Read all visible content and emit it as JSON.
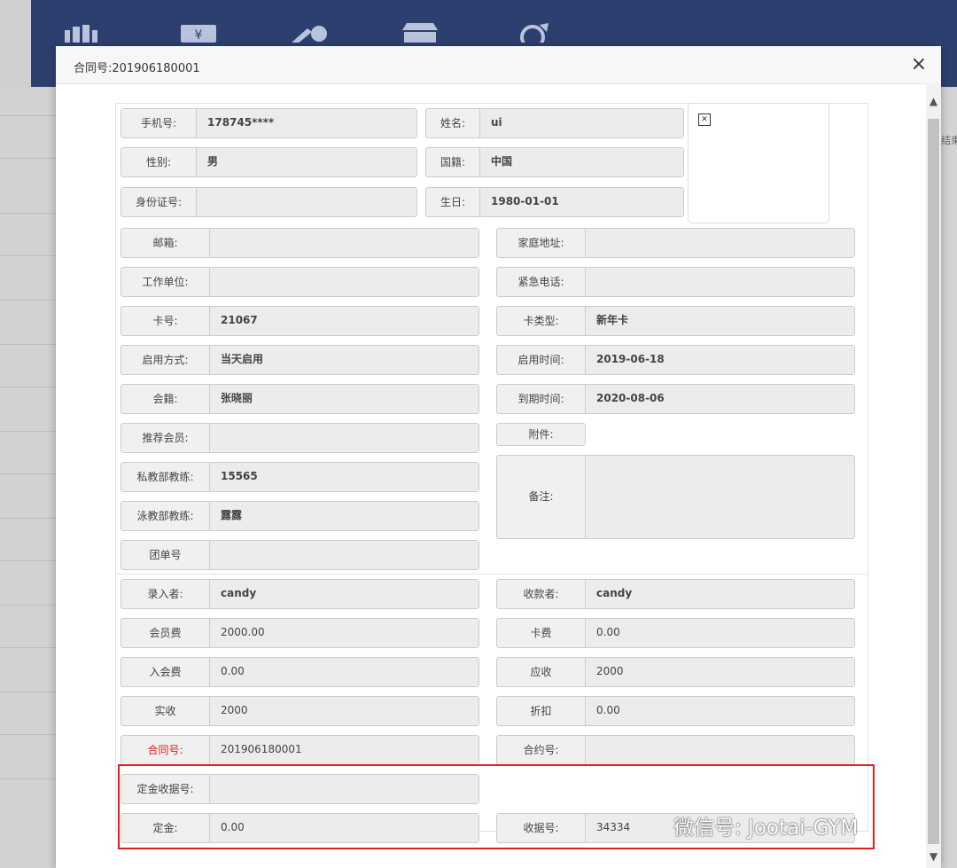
{
  "modal": {
    "title": "合同号:201906180001",
    "close": "×"
  },
  "icons": [
    "books-icon",
    "money-icon",
    "pen-icon",
    "store-icon",
    "wrench-icon"
  ],
  "background": {
    "right_text": "结束"
  },
  "member": {
    "phone": {
      "label": "手机号:",
      "value": "178745****"
    },
    "name": {
      "label": "姓名:",
      "value": "ui"
    },
    "gender": {
      "label": "性别:",
      "value": "男"
    },
    "nationality": {
      "label": "国籍:",
      "value": "中国"
    },
    "id_number": {
      "label": "身份证号:",
      "value": ""
    },
    "birthday": {
      "label": "生日:",
      "value": "1980-01-01"
    },
    "email": {
      "label": "邮箱:",
      "value": ""
    },
    "address": {
      "label": "家庭地址:",
      "value": ""
    },
    "employer": {
      "label": "工作单位:",
      "value": ""
    },
    "emergency_phone": {
      "label": "紧急电话:",
      "value": ""
    },
    "card_no": {
      "label": "卡号:",
      "value": "21067"
    },
    "card_type": {
      "label": "卡类型:",
      "value": "新年卡"
    },
    "activation": {
      "label": "启用方式:",
      "value": "当天启用"
    },
    "activation_date": {
      "label": "启用时间:",
      "value": "2019-06-18"
    },
    "membership": {
      "label": "会籍:",
      "value": "张晓丽"
    },
    "expiry": {
      "label": "到期时间:",
      "value": "2020-08-06"
    },
    "referrer": {
      "label": "推荐会员:",
      "value": ""
    },
    "attachment": {
      "label": "附件:",
      "value": ""
    },
    "pt_coach": {
      "label": "私教部教练:",
      "value": "15565"
    },
    "notes": {
      "label": "备注:",
      "value": ""
    },
    "swim_coach": {
      "label": "泳教部教练:",
      "value": "露露"
    },
    "group_no": {
      "label": "团单号",
      "value": ""
    }
  },
  "payment": {
    "entered_by": {
      "label": "录入者:",
      "value": "candy"
    },
    "collector": {
      "label": "收款者:",
      "value": "candy"
    },
    "member_fee": {
      "label": "会员费",
      "value": "2000.00"
    },
    "card_fee": {
      "label": "卡费",
      "value": "0.00"
    },
    "join_fee": {
      "label": "入会费",
      "value": "0.00"
    },
    "receivable": {
      "label": "应收",
      "value": "2000"
    },
    "received": {
      "label": "实收",
      "value": "2000"
    },
    "discount": {
      "label": "折扣",
      "value": "0.00"
    },
    "contract_no": {
      "label": "合同号:",
      "value": "201906180001"
    },
    "agreement_no": {
      "label": "合约号:",
      "value": ""
    },
    "deposit_receipt": {
      "label": "定金收据号:",
      "value": ""
    },
    "deposit": {
      "label": "定金:",
      "value": "0.00"
    },
    "receipt_no": {
      "label": "收据号:",
      "value": "34334"
    }
  },
  "watermark": "微信号: Jootai-GYM",
  "colors": {
    "header": "#2d3f6e",
    "highlight": "#e02020"
  }
}
